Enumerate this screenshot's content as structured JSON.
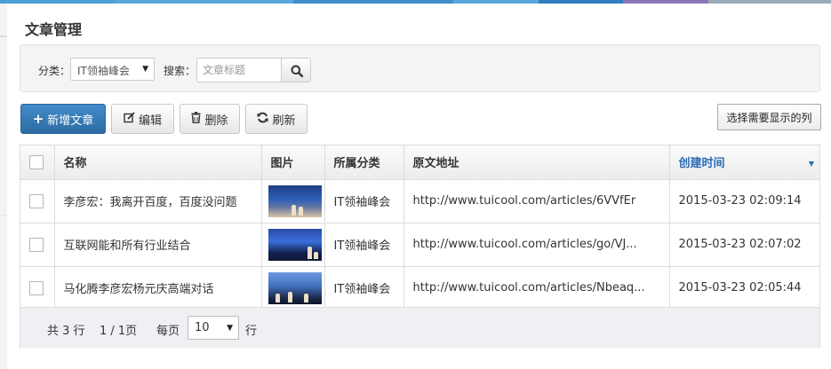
{
  "page": {
    "title": "文章管理"
  },
  "search": {
    "category_label": "分类：",
    "category_value": "IT领袖峰会",
    "keyword_label": "搜索：",
    "keyword_placeholder": "文章标题",
    "icon": "search-icon"
  },
  "toolbar": {
    "add_label": "新增文章",
    "edit_label": "编辑",
    "delete_label": "删除",
    "refresh_label": "刷新",
    "columns_label": "选择需要显示的列",
    "primary_color": "#337ab7"
  },
  "table": {
    "columns": [
      "名称",
      "图片",
      "所属分类",
      "原文地址",
      "创建时间"
    ],
    "sorted_column": "创建时间",
    "sort_direction": "desc",
    "rows": [
      {
        "name": "李彦宏：我离开百度，百度没问题",
        "category": "IT领袖峰会",
        "url": "http://www.tuicool.com/articles/6VVfEr",
        "created": "2015-03-23 02:09:14"
      },
      {
        "name": "互联网能和所有行业结合",
        "category": "IT领袖峰会",
        "url": "http://www.tuicool.com/articles/go/VJ...",
        "created": "2015-03-23 02:07:02"
      },
      {
        "name": "马化腾李彦宏杨元庆高端对话",
        "category": "IT领袖峰会",
        "url": "http://www.tuicool.com/articles/Nbeaq...",
        "created": "2015-03-23 02:05:44"
      }
    ]
  },
  "pager": {
    "total": "共 3 行",
    "pages": "1 / 1页",
    "per_page_label": "每页",
    "per_page_value": "10",
    "rows_unit": "行"
  }
}
